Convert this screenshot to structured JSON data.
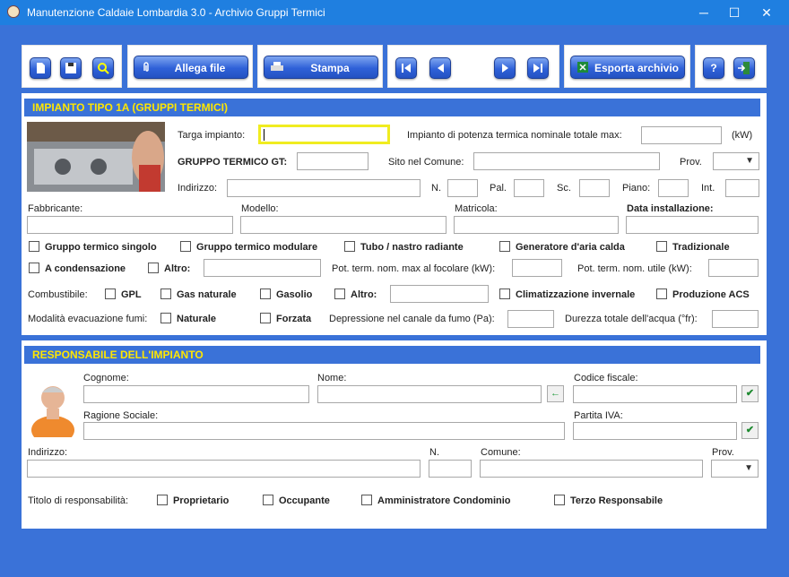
{
  "window": {
    "title": "Manutenzione Caldaie Lombardia 3.0 - Archivio Gruppi Termici",
    "min": "─",
    "max": "☐",
    "close": "✕"
  },
  "toolbar": {
    "attach": "Allega file",
    "print": "Stampa",
    "export": "Esporta archivio",
    "help": "?"
  },
  "section1": {
    "title": "IMPIANTO TIPO 1A (GRUPPI TERMICI)",
    "targa": "Targa impianto:",
    "potenza": "Impianto di potenza termica nominale totale max:",
    "kw": "(kW)",
    "gruppo": "GRUPPO TERMICO GT:",
    "sito": "Sito nel Comune:",
    "prov": "Prov.",
    "indirizzo": "Indirizzo:",
    "n": "N.",
    "pal": "Pal.",
    "sc": "Sc.",
    "piano": "Piano:",
    "int": "Int.",
    "fabbricante": "Fabbricante:",
    "modello": "Modello:",
    "matricola": "Matricola:",
    "data_inst": "Data installazione:",
    "cb_row1": [
      "Gruppo termico singolo",
      "Gruppo termico modulare",
      "Tubo / nastro radiante",
      "Generatore d'aria calda",
      "Tradizionale"
    ],
    "cb_condensazione": "A condensazione",
    "cb_altro": "Altro:",
    "pot_focolare": "Pot. term. nom. max al focolare (kW):",
    "pot_utile": "Pot. term. nom. utile (kW):",
    "combustibile": "Combustibile:",
    "cb_comb": [
      "GPL",
      "Gas naturale",
      "Gasolio"
    ],
    "cb_altro2": "Altro:",
    "cb_clima": "Climatizzazione invernale",
    "cb_acs": "Produzione ACS",
    "evacuazione": "Modalità evacuazione fumi:",
    "cb_naturale": "Naturale",
    "cb_forzata": "Forzata",
    "depressione": "Depressione nel canale da fumo (Pa):",
    "durezza": "Durezza totale dell'acqua (°fr):"
  },
  "section2": {
    "title": "RESPONSABILE DELL'IMPIANTO",
    "cognome": "Cognome:",
    "nome": "Nome:",
    "codice_fiscale": "Codice fiscale:",
    "ragione": "Ragione Sociale:",
    "piva": "Partita IVA:",
    "indirizzo": "Indirizzo:",
    "n": "N.",
    "comune": "Comune:",
    "prov": "Prov.",
    "titolo": "Titolo di responsabilità:",
    "cb_titolo": [
      "Proprietario",
      "Occupante",
      "Amministratore Condominio",
      "Terzo Responsabile"
    ]
  }
}
